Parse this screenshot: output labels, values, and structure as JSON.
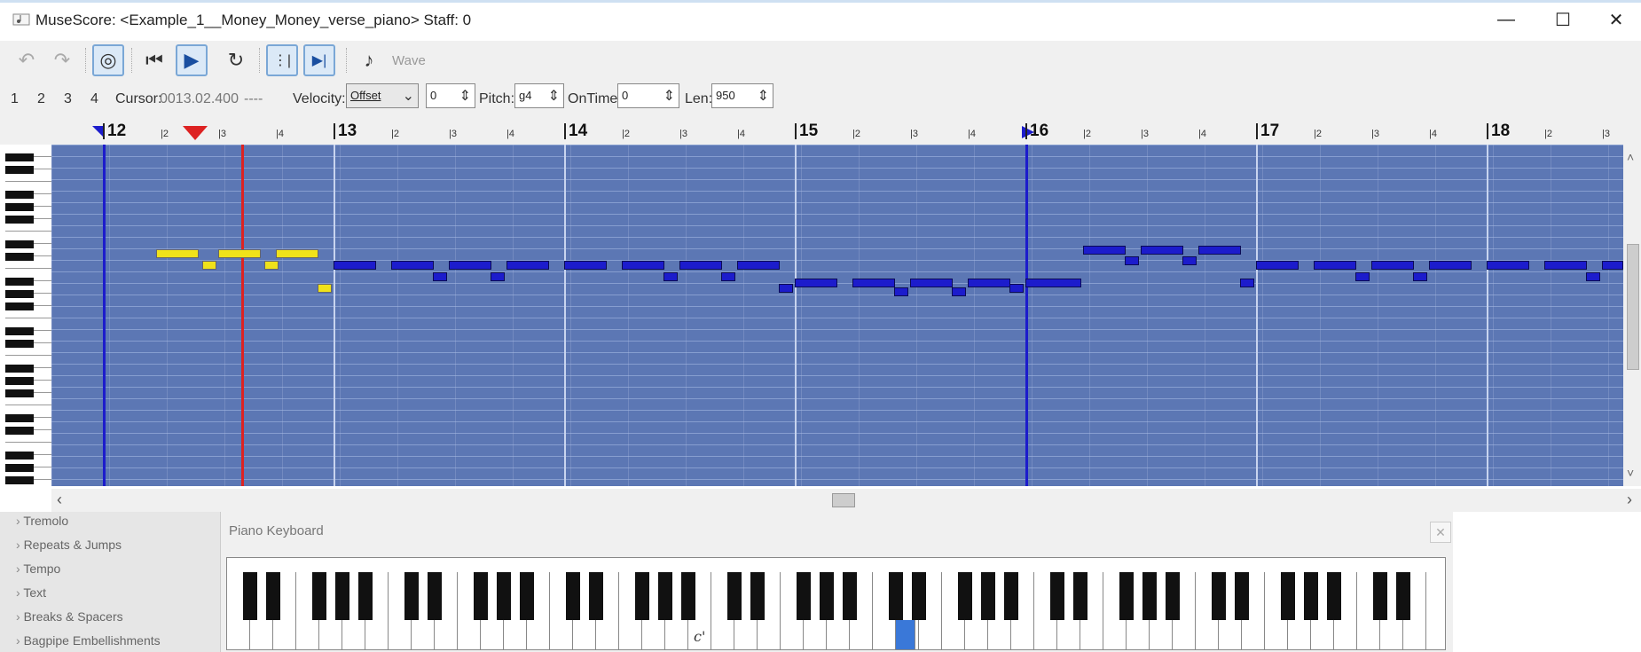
{
  "window": {
    "title": "MuseScore: <Example_1__Money_Money_verse_piano> Staff: 0",
    "controls": [
      "—",
      "☐",
      "✕"
    ]
  },
  "toolbar": {
    "undo_icon": "↶",
    "redo_icon": "↷",
    "metronome_toggle_icon": "◎",
    "rewind_icon": "⏮",
    "play_icon": "▶",
    "loop_icon": "↻",
    "loop_in_icon": "⋮|",
    "loop_out_icon": "▶|",
    "metronome_icon": "♪",
    "wave_label": "Wave"
  },
  "options": {
    "voices": [
      "1",
      "2",
      "3",
      "4"
    ],
    "cursor_label": "Cursor:",
    "cursor_value": "0013.02.400",
    "cursor_trailer": "----",
    "velocity_label": "Velocity:",
    "velocity_mode": "Offset",
    "velocity_value": "0",
    "pitch_label": "Pitch:",
    "pitch_value": "g4",
    "ontime_label": "OnTime:",
    "ontime_value": "0",
    "len_label": "Len:",
    "len_value": "950"
  },
  "ruler": {
    "bars": [
      "12",
      "13",
      "14",
      "15",
      "16",
      "17",
      "18"
    ],
    "beats": [
      "|2",
      "|3",
      "|4"
    ]
  },
  "piano_roll": {
    "playhead_measure": 12.6,
    "loop_in_measure": 12,
    "loop_out_measure": 16
  },
  "palette": {
    "items": [
      "Tremolo",
      "Repeats & Jumps",
      "Tempo",
      "Text",
      "Breaks & Spacers",
      "Bagpipe Embellishments"
    ]
  },
  "piano_keyboard": {
    "title": "Piano Keyboard",
    "close_icon": "✕",
    "key_label": "c'"
  },
  "colors": {
    "roll_background": "#5c77b4",
    "selected_note": "#f0e21a",
    "unselected_note": "#1c1ccc",
    "playhead": "#dd2222",
    "loop_marker": "#1c1ccc",
    "highlighted_key": "#3a78d8"
  }
}
